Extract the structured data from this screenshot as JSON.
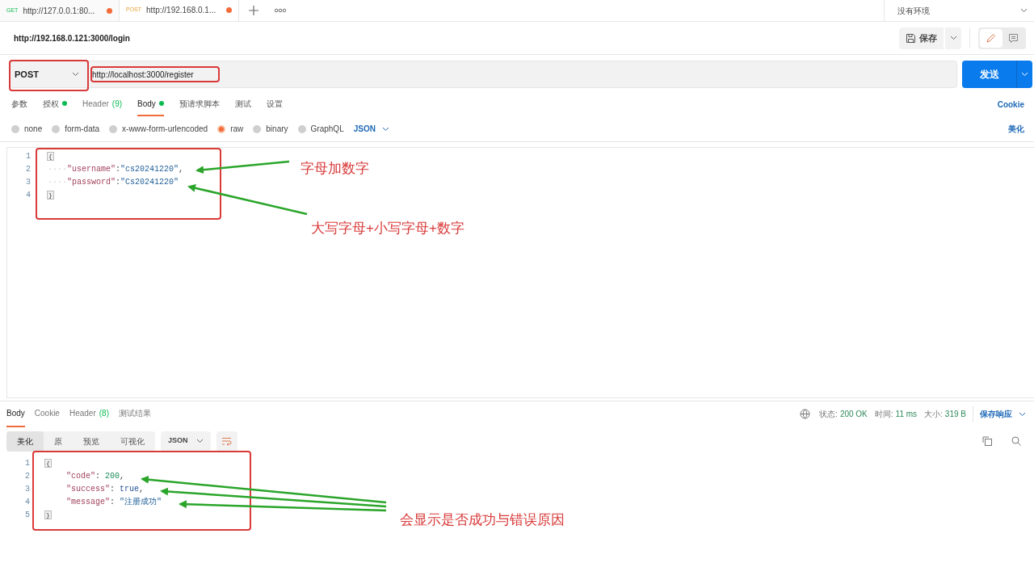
{
  "request_tabs": [
    {
      "method": "GET",
      "title": "http://127.0.0.1:80...",
      "unsaved": true,
      "selected": false
    },
    {
      "method": "POST",
      "title": "http://192.168.0.1...",
      "unsaved": true,
      "selected": true
    }
  ],
  "environment": {
    "value": "没有环境"
  },
  "request": {
    "name": "http://192.168.0.121:3000/login",
    "save_label": "保存",
    "method": "POST",
    "url": "http://localhost:3000/register",
    "send_label": "发送"
  },
  "option_tabs": [
    {
      "label": "参数",
      "dot": false,
      "selected": false
    },
    {
      "label": "授权",
      "dot": true,
      "selected": false
    },
    {
      "label": "Header",
      "count": "(9)",
      "dot": false,
      "selected": false
    },
    {
      "label": "Body",
      "dot": true,
      "selected": true
    },
    {
      "label": "预请求脚本",
      "dot": false,
      "selected": false
    },
    {
      "label": "测试",
      "dot": false,
      "selected": false
    },
    {
      "label": "设置",
      "dot": false,
      "selected": false
    }
  ],
  "cookie_link": "Cookie",
  "body_types": [
    {
      "label": "none",
      "selected": false
    },
    {
      "label": "form-data",
      "selected": false
    },
    {
      "label": "x-www-form-urlencoded",
      "selected": false
    },
    {
      "label": "raw",
      "selected": true
    },
    {
      "label": "binary",
      "selected": false
    },
    {
      "label": "GraphQL",
      "selected": false
    }
  ],
  "body_format": "JSON",
  "beautify_link": "美化",
  "request_body": [
    {
      "number": "1",
      "tokens": [
        {
          "kind": "brace",
          "text": "{"
        }
      ]
    },
    {
      "number": "2",
      "tokens": [
        {
          "kind": "guide",
          "text": "····"
        },
        {
          "kind": "key",
          "text": "\"username\""
        },
        {
          "kind": "punct",
          "text": ":"
        },
        {
          "kind": "string",
          "text": "\"cs20241220\""
        },
        {
          "kind": "punct",
          "text": ","
        }
      ]
    },
    {
      "number": "3",
      "tokens": [
        {
          "kind": "guide",
          "text": "····"
        },
        {
          "kind": "key",
          "text": "\"password\""
        },
        {
          "kind": "punct",
          "text": ":"
        },
        {
          "kind": "string",
          "text": "\"Cs20241220\""
        }
      ]
    },
    {
      "number": "4",
      "tokens": [
        {
          "kind": "brace",
          "text": "}"
        }
      ]
    }
  ],
  "response_tabs": [
    {
      "label": "Body",
      "selected": true
    },
    {
      "label": "Cookie",
      "selected": false
    },
    {
      "label": "Header",
      "count": "(8)",
      "selected": false
    },
    {
      "label": "测试结果",
      "selected": false
    }
  ],
  "response_meta": [
    {
      "label": "状态:",
      "value": "200 OK"
    },
    {
      "label": "时间:",
      "value": "11 ms"
    },
    {
      "label": "大小:",
      "value": "319 B"
    }
  ],
  "save_response_label": "保存响应",
  "view_modes": [
    {
      "label": "美化",
      "selected": true
    },
    {
      "label": "原",
      "selected": false
    },
    {
      "label": "预览",
      "selected": false
    },
    {
      "label": "可视化",
      "selected": false
    }
  ],
  "response_format": "JSON",
  "view_toggle": [
    {
      "kind": "edit",
      "selected": true
    },
    {
      "kind": "comments",
      "selected": false
    }
  ],
  "response_body": [
    {
      "number": "1",
      "tokens": [
        {
          "kind": "brace",
          "text": "{"
        }
      ],
      "children": [
        {
          "number": "2",
          "tokens": [
            {
              "kind": "key",
              "text": "\"code\""
            },
            {
              "kind": "punct",
              "text": ": "
            },
            {
              "kind": "number",
              "text": "200"
            },
            {
              "kind": "punct",
              "text": ","
            }
          ]
        },
        {
          "number": "3",
          "tokens": [
            {
              "kind": "key",
              "text": "\"success\""
            },
            {
              "kind": "punct",
              "text": ": "
            },
            {
              "kind": "bool",
              "text": "true"
            },
            {
              "kind": "punct",
              "text": ","
            }
          ]
        },
        {
          "number": "4",
          "tokens": [
            {
              "kind": "key",
              "text": "\"message\""
            },
            {
              "kind": "punct",
              "text": ": "
            },
            {
              "kind": "string",
              "text": "\"注册成功\""
            }
          ]
        }
      ]
    },
    {
      "number": "5",
      "tokens": [
        {
          "kind": "brace",
          "text": "}"
        }
      ]
    }
  ],
  "annotations": [
    "字母加数字",
    "大写字母+小写字母+数字",
    "会显示是否成功与错误原因"
  ]
}
